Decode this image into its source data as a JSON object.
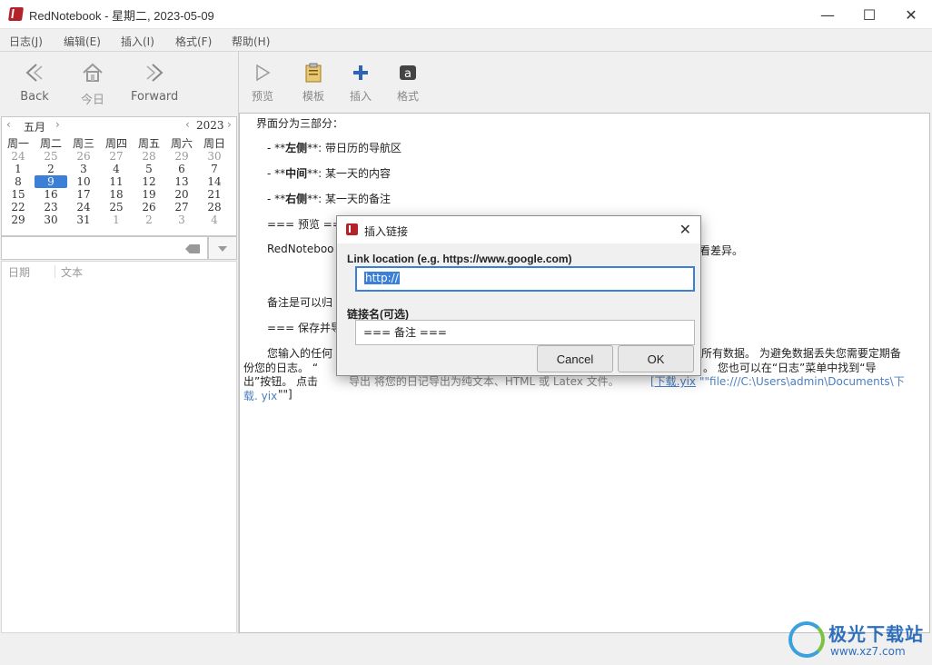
{
  "window": {
    "title": "RedNotebook - 星期二, 2023-05-09",
    "minimize": "—",
    "maximize": "☐",
    "close": "✕"
  },
  "menu": [
    "日志(J)",
    "编辑(E)",
    "插入(I)",
    "格式(F)",
    "帮助(H)"
  ],
  "nav": {
    "back": "Back",
    "today": "今日",
    "forward": "Forward"
  },
  "calendar": {
    "month": "五月",
    "year": "2023",
    "weekdays": [
      "周一",
      "周二",
      "周三",
      "周四",
      "周五",
      "周六",
      "周日"
    ],
    "weeks": [
      [
        "24",
        "25",
        "26",
        "27",
        "28",
        "29",
        "30"
      ],
      [
        "1",
        "2",
        "3",
        "4",
        "5",
        "6",
        "7"
      ],
      [
        "8",
        "9",
        "10",
        "11",
        "12",
        "13",
        "14"
      ],
      [
        "15",
        "16",
        "17",
        "18",
        "19",
        "20",
        "21"
      ],
      [
        "22",
        "23",
        "24",
        "25",
        "26",
        "27",
        "28"
      ],
      [
        "29",
        "30",
        "31",
        "1",
        "2",
        "3",
        "4"
      ]
    ],
    "selected": "9"
  },
  "search": {
    "value": ""
  },
  "results": {
    "col_date": "日期",
    "col_text": "文本"
  },
  "editor_toolbar": {
    "preview": "预览",
    "template": "模板",
    "insert": "插入",
    "format": "格式"
  },
  "editor": {
    "line1": "界面分为三部分：",
    "item1_prefix": "- **",
    "item1_bold": "左侧",
    "item1_suffix": "**: 带日历的导航区",
    "item2_prefix": "- **",
    "item2_bold": "中间",
    "item2_suffix": "**: 某一天的内容",
    "item3_prefix": "- **",
    "item3_bold": "右侧",
    "item3_suffix": "**: 某一天的备注",
    "preview_head": "=== 预览 ==",
    "rednotebook_start": "RedNoteboo",
    "rednotebook_end": "看差异。",
    "notes_start": "备注是可以归",
    "save_start": "=== 保存并导",
    "para_start": "您输入的任何",
    "para_end": "所有数据。 为避免数据丢失您需要定期备",
    "para_line2a": "份您的日志。 “",
    "para_line2b": "。 您也可以在“日志”菜单中找到“导",
    "para_line3a": "出”按钮。 点击",
    "para_line3b": "导出 将您的日记导出为纯文本、HTML 或 Latex 文件。",
    "link_text": "[下载.yix",
    "link_path": "\"\"file:///C:\\Users\\admin\\Documents\\下",
    "link_line2": "载. yix",
    "link_line2_end": "\"\"]"
  },
  "dialog": {
    "title": "插入链接",
    "close": "✕",
    "link_label": "Link location (e.g. https://www.google.com)",
    "link_value": "http://",
    "name_label": "链接名(可选)",
    "name_value": "=== 备注 ===",
    "cancel": "Cancel",
    "ok": "OK"
  },
  "watermark": {
    "brand": "极光下载站",
    "url": "www.xz7.com"
  }
}
